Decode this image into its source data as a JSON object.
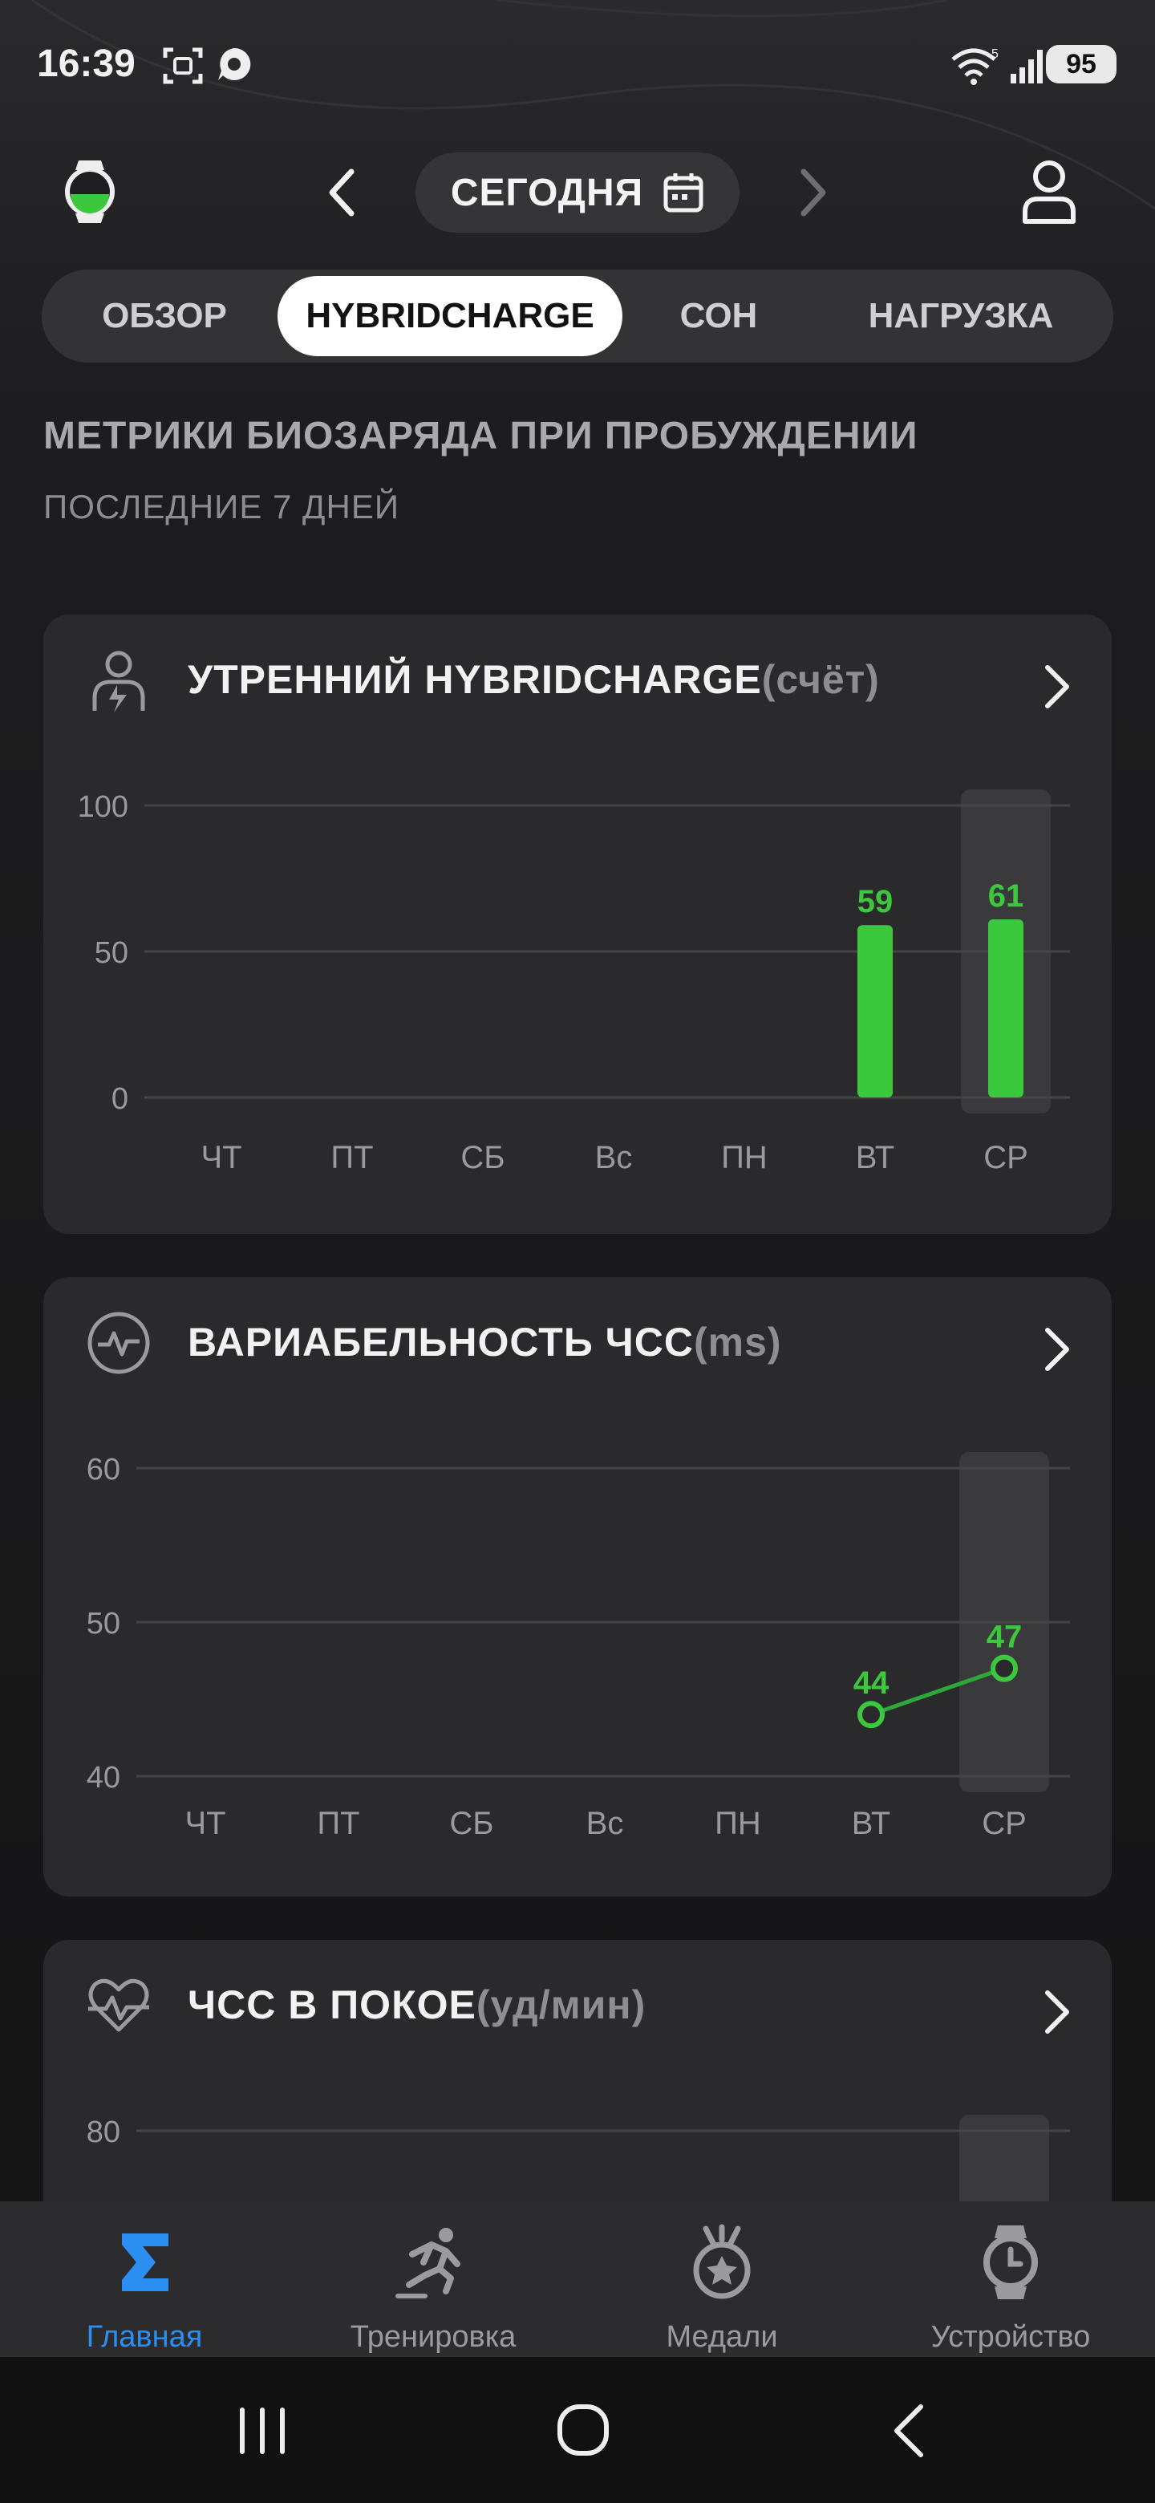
{
  "status_bar": {
    "time": "16:39",
    "battery": "95",
    "icons": [
      "screenshot-icon",
      "chat-bubble-icon",
      "wifi-icon",
      "signal-icon"
    ]
  },
  "header": {
    "date_label": "СЕГОДНЯ",
    "icons": [
      "watch-icon",
      "chevron-left-icon",
      "calendar-icon",
      "chevron-right-icon",
      "profile-icon"
    ]
  },
  "tabs": [
    {
      "label": "ОБЗОР",
      "active": false
    },
    {
      "label": "HYBRIDCHARGE",
      "active": true
    },
    {
      "label": "СОН",
      "active": false
    },
    {
      "label": "НАГРУЗКА",
      "active": false
    }
  ],
  "section": {
    "title": "МЕТРИКИ БИОЗАРЯДА ПРИ ПРОБУЖДЕНИИ",
    "subtitle": "ПОСЛЕДНИЕ 7 ДНЕЙ"
  },
  "cards": [
    {
      "title": "УТРЕННИЙ HYBRIDCHARGE",
      "unit": "(счёт)",
      "icon": "body-charge-icon"
    },
    {
      "title": "ВАРИАБЕЛЬНОСТЬ ЧСС",
      "unit": "(ms)",
      "icon": "hrv-pulse-icon"
    },
    {
      "title": "ЧСС В ПОКОЕ",
      "unit": "(уд/мин)",
      "icon": "resting-heart-icon"
    }
  ],
  "colors": {
    "accent_green": "#3cc83c",
    "line_green": "#2ea83a",
    "active_blue": "#2a8ff0",
    "card_bg": "#2a2a2d"
  },
  "chart_data": [
    {
      "type": "bar",
      "categories": [
        "ЧТ",
        "ПТ",
        "СБ",
        "Вс",
        "ПН",
        "ВТ",
        "СР"
      ],
      "values": [
        null,
        null,
        null,
        null,
        null,
        59,
        61
      ],
      "yticks": [
        0,
        50,
        100
      ],
      "ylim": [
        0,
        100
      ],
      "highlighted_category": "СР",
      "grid": true
    },
    {
      "type": "line",
      "categories": [
        "ЧТ",
        "ПТ",
        "СБ",
        "Вс",
        "ПН",
        "ВТ",
        "СР"
      ],
      "values": [
        null,
        null,
        null,
        null,
        null,
        44,
        47
      ],
      "yticks": [
        40,
        50,
        60
      ],
      "ylim": [
        40,
        60
      ],
      "highlighted_category": "СР",
      "grid": true
    },
    {
      "type": "line",
      "yticks": [
        80
      ],
      "highlighted_category": "СР",
      "grid": true
    }
  ],
  "bottom_nav": [
    {
      "label": "Главная",
      "icon": "sigma-home-icon",
      "active": true
    },
    {
      "label": "Тренировка",
      "icon": "runner-icon",
      "active": false
    },
    {
      "label": "Медали",
      "icon": "medal-icon",
      "active": false
    },
    {
      "label": "Устройство",
      "icon": "watch-device-icon",
      "active": false
    }
  ],
  "system_nav": [
    "recents-icon",
    "home-icon",
    "back-icon"
  ]
}
